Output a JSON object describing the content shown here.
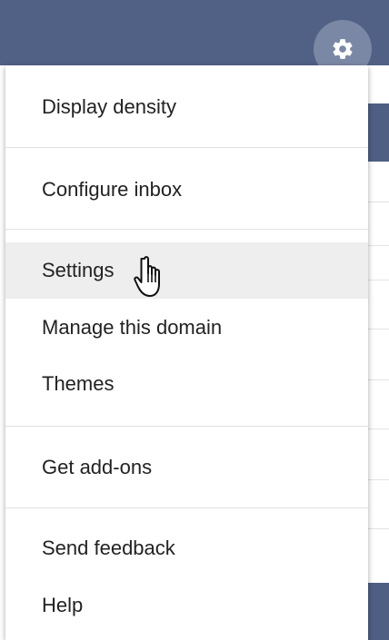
{
  "menu": {
    "items": [
      {
        "label": "Display density"
      },
      {
        "label": "Configure inbox"
      },
      {
        "label": "Settings"
      },
      {
        "label": "Manage this domain"
      },
      {
        "label": "Themes"
      },
      {
        "label": "Get add-ons"
      },
      {
        "label": "Send feedback"
      },
      {
        "label": "Help"
      }
    ],
    "hovered_item": "Settings"
  },
  "colors": {
    "header": "#506185",
    "gear_button": "#7b88a5",
    "hover_background": "#eeeeee",
    "text": "#222222"
  },
  "icons": {
    "settings_button": "gear-icon",
    "pointer": "hand-cursor-icon"
  }
}
